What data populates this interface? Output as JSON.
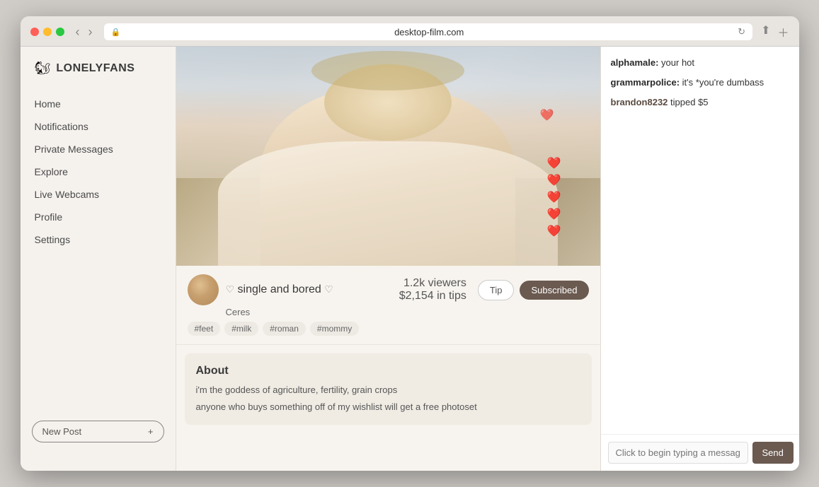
{
  "browser": {
    "url": "desktop-film.com",
    "back_arrow": "‹",
    "forward_arrow": "›"
  },
  "app": {
    "logo_icon": "🐿",
    "logo_text": "LONELYFANS"
  },
  "sidebar": {
    "nav_items": [
      {
        "id": "home",
        "label": "Home"
      },
      {
        "id": "notifications",
        "label": "Notifications"
      },
      {
        "id": "private-messages",
        "label": "Private Messages"
      },
      {
        "id": "explore",
        "label": "Explore"
      },
      {
        "id": "live-webcams",
        "label": "Live Webcams"
      },
      {
        "id": "profile",
        "label": "Profile"
      },
      {
        "id": "settings",
        "label": "Settings"
      }
    ],
    "new_post_label": "New Post",
    "new_post_icon": "+"
  },
  "stream": {
    "title_prefix_heart": "♡",
    "title": "single and bored",
    "title_suffix_heart": "♡",
    "streamer_name": "Ceres",
    "viewers": "1.2k viewers",
    "tips": "$2,154 in tips",
    "tip_button": "Tip",
    "subscribed_button": "Subscribed",
    "tags": [
      "#feet",
      "#milk",
      "#roman",
      "#mommy"
    ],
    "hearts": [
      "❤️",
      "❤️",
      "❤️",
      "❤️",
      "❤️"
    ],
    "small_heart": "❤️"
  },
  "about": {
    "title": "About",
    "line1": "i'm the goddess of agriculture, fertility, grain crops",
    "line2": "anyone who buys something off of my wishlist will get a free photoset"
  },
  "chat": {
    "messages": [
      {
        "username": "alphamale",
        "text": "your hot",
        "type": "normal"
      },
      {
        "username": "grammarpolice",
        "text": "it's *you're dumbass",
        "type": "normal"
      },
      {
        "username": "brandon8232",
        "text": "tipped $5",
        "type": "tip"
      }
    ],
    "input_placeholder": "Click to begin typing a message",
    "send_label": "Send"
  }
}
